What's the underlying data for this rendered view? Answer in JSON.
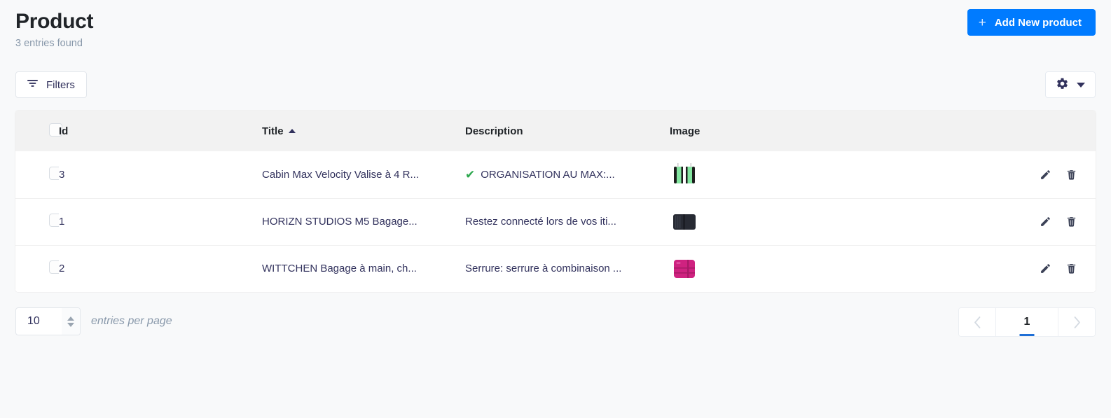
{
  "header": {
    "title": "Product",
    "entries_found": "3 entries found",
    "add_button_label": "Add New product",
    "plus_icon": "plus-icon"
  },
  "toolbar": {
    "filters_label": "Filters",
    "filter_icon": "filter-icon",
    "gear_icon": "gear-icon",
    "caret_icon": "chevron-down-icon"
  },
  "table": {
    "columns": [
      {
        "key": "select",
        "label": ""
      },
      {
        "key": "id",
        "label": "Id"
      },
      {
        "key": "title",
        "label": "Title",
        "sort": "asc"
      },
      {
        "key": "description",
        "label": "Description"
      },
      {
        "key": "image",
        "label": "Image"
      }
    ],
    "rows": [
      {
        "id": "3",
        "title": "Cabin Max Velocity Valise à 4 R...",
        "description": "ORGANISATION AU MAX:...",
        "description_prefix_icon": "green-check-emoji",
        "image_alt": "green-suitcase-thumbnail",
        "edit_label": "pencil-icon",
        "delete_label": "trash-icon"
      },
      {
        "id": "1",
        "title": "HORIZN STUDIOS M5 Bagage...",
        "description": "Restez connecté lors de vos iti...",
        "description_prefix_icon": "",
        "image_alt": "black-suitcase-thumbnail",
        "edit_label": "pencil-icon",
        "delete_label": "trash-icon"
      },
      {
        "id": "2",
        "title": "WITTCHEN Bagage à main, ch...",
        "description": "Serrure: serrure à combinaison ...",
        "description_prefix_icon": "",
        "image_alt": "pink-suitcase-thumbnail",
        "edit_label": "pencil-icon",
        "delete_label": "trash-icon"
      }
    ]
  },
  "footer": {
    "entries_per_page_value": "10",
    "entries_per_page_label": "entries per page",
    "prev_icon": "chevron-left-icon",
    "next_icon": "chevron-right-icon",
    "current_page": "1"
  },
  "colors": {
    "accent_blue": "#007bff",
    "page_bg": "#f8f9fa",
    "header_row_bg": "#f2f2f2",
    "text_dark": "#212529",
    "text_muted": "#8898aa",
    "active_page_underline": "#1f6fd6",
    "check_green": "#2ea84f"
  }
}
